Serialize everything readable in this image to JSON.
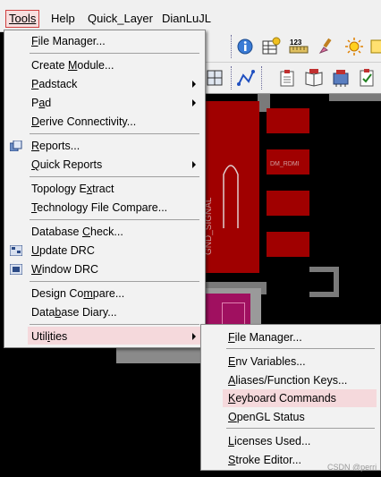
{
  "menubar": {
    "items": [
      {
        "label": "Tools",
        "underline": "T"
      },
      {
        "label": "Help",
        "underline": "H"
      },
      {
        "label": "Quick_Layer",
        "underline": "Q"
      },
      {
        "label": "DianLuJL",
        "underline": ""
      }
    ]
  },
  "tools_menu": {
    "items": [
      {
        "pre": "",
        "u": "F",
        "post": "ile Manager...",
        "arrow": false
      },
      {
        "pre": "Create ",
        "u": "M",
        "post": "odule...",
        "arrow": false
      },
      {
        "pre": "",
        "u": "P",
        "post": "adstack",
        "arrow": true
      },
      {
        "pre": "P",
        "u": "a",
        "post": "d",
        "arrow": true
      },
      {
        "pre": "",
        "u": "D",
        "post": "erive Connectivity...",
        "arrow": false
      },
      {
        "pre": "",
        "u": "R",
        "post": "eports...",
        "arrow": false
      },
      {
        "pre": "",
        "u": "Q",
        "post": "uick Reports",
        "arrow": true
      },
      {
        "pre": "Topology E",
        "u": "x",
        "post": "tract",
        "arrow": false
      },
      {
        "pre": "",
        "u": "T",
        "post": "echnology File Compare...",
        "arrow": false
      },
      {
        "pre": "Database ",
        "u": "C",
        "post": "heck...",
        "arrow": false
      },
      {
        "pre": "",
        "u": "U",
        "post": "pdate DRC",
        "arrow": false
      },
      {
        "pre": "",
        "u": "W",
        "post": "indow DRC",
        "arrow": false
      },
      {
        "pre": "Design Co",
        "u": "m",
        "post": "pare...",
        "arrow": false
      },
      {
        "pre": "Data",
        "u": "b",
        "post": "ase Diary...",
        "arrow": false
      },
      {
        "pre": "Util",
        "u": "i",
        "post": "ties",
        "arrow": true
      }
    ]
  },
  "utilities_menu": {
    "items": [
      {
        "pre": "",
        "u": "F",
        "post": "ile Manager..."
      },
      {
        "pre": "",
        "u": "E",
        "post": "nv Variables..."
      },
      {
        "pre": "",
        "u": "A",
        "post": "liases/Function Keys..."
      },
      {
        "pre": "",
        "u": "K",
        "post": "eyboard Commands"
      },
      {
        "pre": "",
        "u": "O",
        "post": "penGL Status"
      },
      {
        "pre": "",
        "u": "L",
        "post": "icenses Used..."
      },
      {
        "pre": "",
        "u": "S",
        "post": "troke Editor..."
      }
    ]
  },
  "canvas": {
    "signal_label": "GND_SIGNAL",
    "pad_label": "DM_RDMI"
  },
  "watermark": "CSDN @perri",
  "colors": {
    "highlight": "#f5d9dc",
    "pad_red": "#a00000",
    "canvas_bg": "#000000"
  }
}
